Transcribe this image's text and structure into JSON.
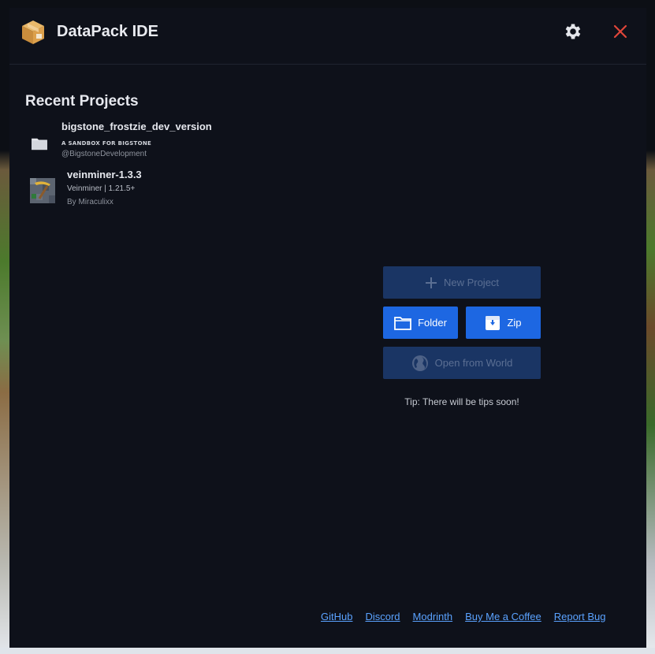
{
  "app": {
    "title": "DataPack IDE",
    "logo_icon": "package-box-icon"
  },
  "titlebar": {
    "settings_icon": "gear-icon",
    "close_icon": "close-icon",
    "close_color": "#e0463a"
  },
  "recent": {
    "title": "Recent Projects",
    "projects": [
      {
        "name": "bigstone_frostzie_dev_version",
        "description": "A SANDBOX FOR BIGSTONE",
        "meta": "",
        "author": "@BigstoneDevelopment",
        "icon": "folder-icon"
      },
      {
        "name": "veinminer-1.3.3",
        "description": "",
        "meta": "Veinminer | 1.21.5+",
        "author": "By Miraculixx",
        "icon": "pickaxe-icon"
      }
    ]
  },
  "actions": {
    "new_project": "New Project",
    "folder": "Folder",
    "zip": "Zip",
    "open_world": "Open from World",
    "accent": "#1d67e2",
    "disabled_bg": "#1a3564"
  },
  "tip": "Tip: There will be tips soon!",
  "footer": {
    "links": [
      "GitHub",
      "Discord",
      "Modrinth",
      "Buy Me a Coffee",
      "Report Bug"
    ],
    "link_color": "#5aa2ff"
  }
}
